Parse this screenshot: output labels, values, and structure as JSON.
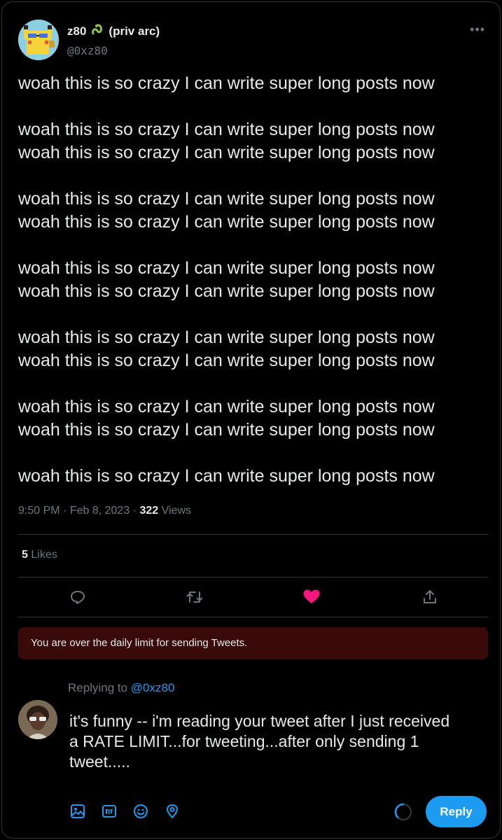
{
  "author": {
    "display_name": "z80",
    "tag": "(priv arc)",
    "handle": "@0xz80",
    "avatar_icon": "pixel-pikachu-avatar"
  },
  "tweet": {
    "paragraphs": [
      [
        "woah this is so crazy I can write super long posts now"
      ],
      [
        "woah this is so crazy I can write super long posts now",
        "woah this is so crazy I can write super long posts now"
      ],
      [
        "woah this is so crazy I can write super long posts now",
        "woah this is so crazy I can write super long posts now"
      ],
      [
        "woah this is so crazy I can write super long posts now",
        "woah this is so crazy I can write super long posts now"
      ],
      [
        "woah this is so crazy I can write super long posts now",
        "woah this is so crazy I can write super long posts now"
      ],
      [
        "woah this is so crazy I can write super long posts now",
        "woah this is so crazy I can write super long posts now"
      ],
      [
        "woah this is so crazy I can write super long posts now"
      ]
    ],
    "time": "9:50 PM",
    "date": "Feb 8, 2023",
    "views_count": "322",
    "views_label": "Views",
    "likes_count": "5",
    "likes_label": "Likes"
  },
  "error_banner": "You are over the daily limit for sending Tweets.",
  "reply": {
    "replying_to_label": "Replying to",
    "replying_to_handle": "@0xz80",
    "text_lines": [
      "it's funny -- i'm reading your tweet after I just received",
      "a RATE LIMIT...for tweeting...after only sending 1",
      "tweet....."
    ],
    "button_label": "Reply"
  },
  "colors": {
    "accent": "#1d9bf0",
    "like": "#f91880",
    "error_bg": "#3a0a0a",
    "muted": "#71767b"
  }
}
